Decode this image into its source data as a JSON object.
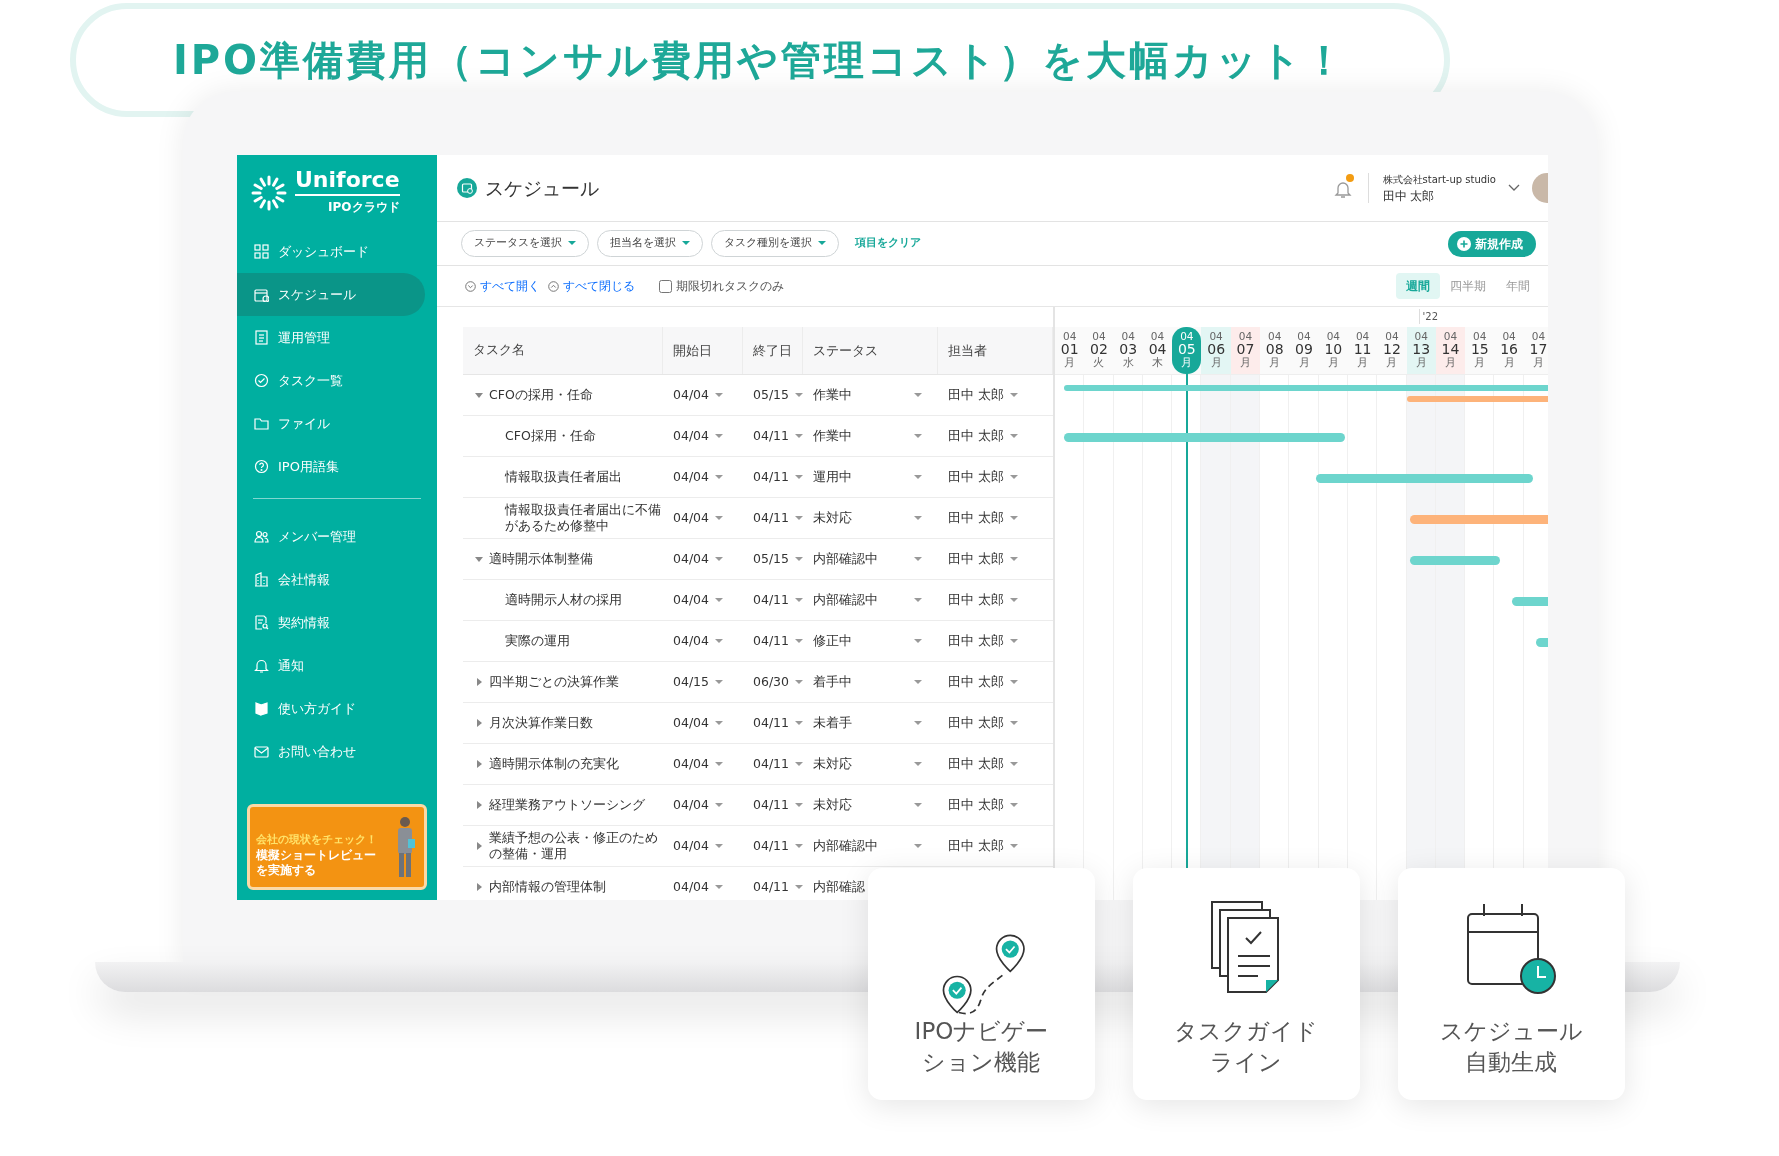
{
  "headline": "IPO準備費用（コンサル費用や管理コスト）を大幅カット！",
  "sidebar": {
    "logo": "Uniforce",
    "logo_sub": "IPOクラウド",
    "items": [
      {
        "label": "ダッシュボード",
        "kind": "grid",
        "selected": false
      },
      {
        "label": "スケジュール",
        "kind": "calendar",
        "selected": true
      },
      {
        "label": "運用管理",
        "kind": "doc",
        "selected": false
      },
      {
        "label": "タスク一覧",
        "kind": "check",
        "selected": false
      },
      {
        "label": "ファイル",
        "kind": "folder",
        "selected": false
      },
      {
        "label": "IPO用語集",
        "kind": "help",
        "selected": false
      }
    ],
    "items_lower": [
      {
        "label": "メンバー管理",
        "kind": "people",
        "selected": false
      },
      {
        "label": "会社情報",
        "kind": "building",
        "selected": false
      },
      {
        "label": "契約情報",
        "kind": "docsearch",
        "selected": false
      },
      {
        "label": "通知",
        "kind": "bell",
        "selected": false
      },
      {
        "label": "使い方ガイド",
        "kind": "mark",
        "selected": false
      },
      {
        "label": "お問い合わせ",
        "kind": "mail",
        "selected": false
      }
    ],
    "promo": {
      "eyebrow": "会社の現状をチェック！",
      "text": "模擬ショートレビューを実施する"
    }
  },
  "header": {
    "title": "スケジュール",
    "company": "株式会社start-up studio",
    "user": "田中 太郎",
    "notification": true
  },
  "filters": [
    {
      "label": "ステータスを選択"
    },
    {
      "label": "担当名を選択"
    },
    {
      "label": "タスク種別を選択"
    }
  ],
  "clear_link": "項目をクリア",
  "new_button": "新規作成",
  "toolbar": {
    "expand_all": "すべて開く",
    "collapse_all": "すべて閉じる",
    "overdue_only": {
      "label": "期限切れタスクのみ",
      "checked": false
    }
  },
  "views": [
    {
      "label": "週間",
      "selected": true
    },
    {
      "label": "四半期",
      "selected": false
    },
    {
      "label": "年間",
      "selected": false
    }
  ],
  "year_label": "'22",
  "table": {
    "columns": [
      "タスク名",
      "開始日",
      "終了日",
      "ステータス",
      "担当者"
    ],
    "rows": [
      {
        "name": "CFOの採用・任命",
        "start": "04/04",
        "end": "05/15",
        "status": "作業中",
        "assignee": "田中 太郎",
        "expanded": true,
        "children": [
          {
            "name": "CFO採用・任命",
            "start": "04/04",
            "end": "04/11",
            "status": "作業中",
            "assignee": "田中 太郎"
          },
          {
            "name": "情報取扱責任者届出",
            "start": "04/04",
            "end": "04/11",
            "status": "運用中",
            "assignee": "田中 太郎"
          },
          {
            "name": "情報取扱責任者届出に不備があるため修整中",
            "start": "04/04",
            "end": "04/11",
            "status": "未対応",
            "assignee": "田中 太郎"
          }
        ]
      },
      {
        "name": "適時開示体制整備",
        "start": "04/04",
        "end": "05/15",
        "status": "内部確認中",
        "assignee": "田中 太郎",
        "expanded": true,
        "children": [
          {
            "name": "適時開示人材の採用",
            "start": "04/04",
            "end": "04/11",
            "status": "内部確認中",
            "assignee": "田中 太郎"
          },
          {
            "name": "実際の運用",
            "start": "04/04",
            "end": "04/11",
            "status": "修正中",
            "assignee": "田中 太郎"
          }
        ]
      },
      {
        "name": "四半期ごとの決算作業",
        "start": "04/15",
        "end": "06/30",
        "status": "着手中",
        "assignee": "田中 太郎",
        "expanded": false
      },
      {
        "name": "月次決算作業日数",
        "start": "04/04",
        "end": "04/11",
        "status": "未着手",
        "assignee": "田中 太郎",
        "expanded": false
      },
      {
        "name": "適時開示体制の充実化",
        "start": "04/04",
        "end": "04/11",
        "status": "未対応",
        "assignee": "田中 太郎",
        "expanded": false
      },
      {
        "name": "経理業務アウトソーシング",
        "start": "04/04",
        "end": "04/11",
        "status": "未対応",
        "assignee": "田中 太郎",
        "expanded": false
      },
      {
        "name": "業績予想の公表・修正のための整備・運用",
        "start": "04/04",
        "end": "04/11",
        "status": "内部確認中",
        "assignee": "田中 太郎",
        "expanded": false
      },
      {
        "name": "内部情報の管理体制",
        "start": "04/04",
        "end": "04/11",
        "status": "内部確認",
        "expanded": false
      }
    ]
  },
  "days": [
    {
      "month": "04",
      "day": "01",
      "weekday": "月",
      "kind": "plain"
    },
    {
      "month": "04",
      "day": "02",
      "weekday": "火",
      "kind": "plain"
    },
    {
      "month": "04",
      "day": "03",
      "weekday": "水",
      "kind": "plain"
    },
    {
      "month": "04",
      "day": "04",
      "weekday": "木",
      "kind": "plain"
    },
    {
      "month": "04",
      "day": "05",
      "weekday": "月",
      "kind": "today"
    },
    {
      "month": "04",
      "day": "06",
      "weekday": "月",
      "kind": "shaded"
    },
    {
      "month": "04",
      "day": "07",
      "weekday": "月",
      "kind": "holiday"
    },
    {
      "month": "04",
      "day": "08",
      "weekday": "月",
      "kind": "plain"
    },
    {
      "month": "04",
      "day": "09",
      "weekday": "月",
      "kind": "plain"
    },
    {
      "month": "04",
      "day": "10",
      "weekday": "月",
      "kind": "plain"
    },
    {
      "month": "04",
      "day": "11",
      "weekday": "月",
      "kind": "plain"
    },
    {
      "month": "04",
      "day": "12",
      "weekday": "月",
      "kind": "plain"
    },
    {
      "month": "04",
      "day": "13",
      "weekday": "月",
      "kind": "shaded"
    },
    {
      "month": "04",
      "day": "14",
      "weekday": "月",
      "kind": "holiday"
    },
    {
      "month": "04",
      "day": "15",
      "weekday": "月",
      "kind": "plain"
    },
    {
      "month": "04",
      "day": "16",
      "weekday": "月",
      "kind": "plain"
    },
    {
      "month": "04",
      "day": "17",
      "weekday": "月",
      "kind": "plain"
    }
  ],
  "features": [
    {
      "label": "IPOナビゲーション機能",
      "kind": "pins"
    },
    {
      "label": "タスクガイドライン",
      "kind": "docs"
    },
    {
      "label": "スケジュール自動生成",
      "kind": "calendar"
    }
  ]
}
